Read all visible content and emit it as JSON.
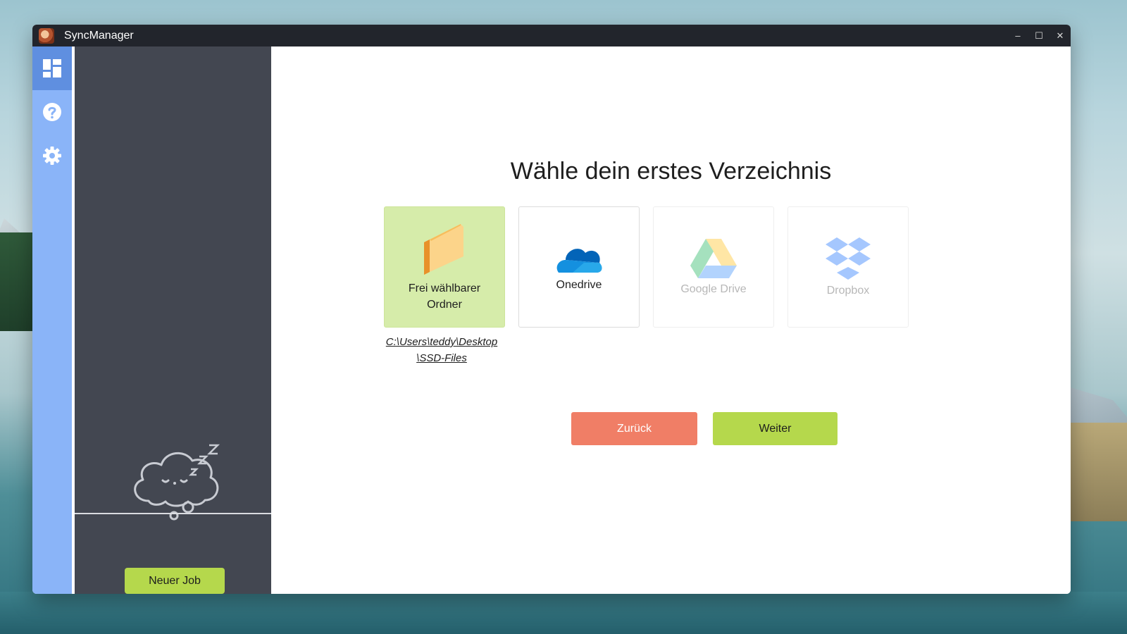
{
  "window": {
    "title": "SyncManager",
    "controls": {
      "minimize": "–",
      "maximize": "☐",
      "close": "✕"
    }
  },
  "rail": {
    "items": [
      {
        "icon": "dashboard-icon",
        "active": true
      },
      {
        "icon": "help-icon",
        "active": false
      },
      {
        "icon": "gear-icon",
        "active": false
      }
    ]
  },
  "sidebar": {
    "illustration": "sleeping-cloud-icon",
    "new_job_label": "Neuer Job"
  },
  "main": {
    "heading": "Wähle dein erstes Verzeichnis",
    "cards": [
      {
        "label_line1": "Frei wählbarer",
        "label_line2": "Ordner",
        "icon": "folder-icon",
        "state": "selected"
      },
      {
        "label": "Onedrive",
        "icon": "onedrive-icon",
        "state": "enabled"
      },
      {
        "label": "Google Drive",
        "icon": "google-drive-icon",
        "state": "disabled"
      },
      {
        "label": "Dropbox",
        "icon": "dropbox-icon",
        "state": "disabled"
      }
    ],
    "selected_path_line1": "C:\\Users\\teddy\\Desktop",
    "selected_path_line2": "\\SSD-Files",
    "back_label": "Zurück",
    "next_label": "Weiter"
  },
  "colors": {
    "titlebar": "#22252c",
    "rail": "#8ab4f8",
    "sidebar": "#434751",
    "selected_card": "#d6ecaa",
    "back_button": "#f07e66",
    "next_button": "#b5d84c"
  }
}
